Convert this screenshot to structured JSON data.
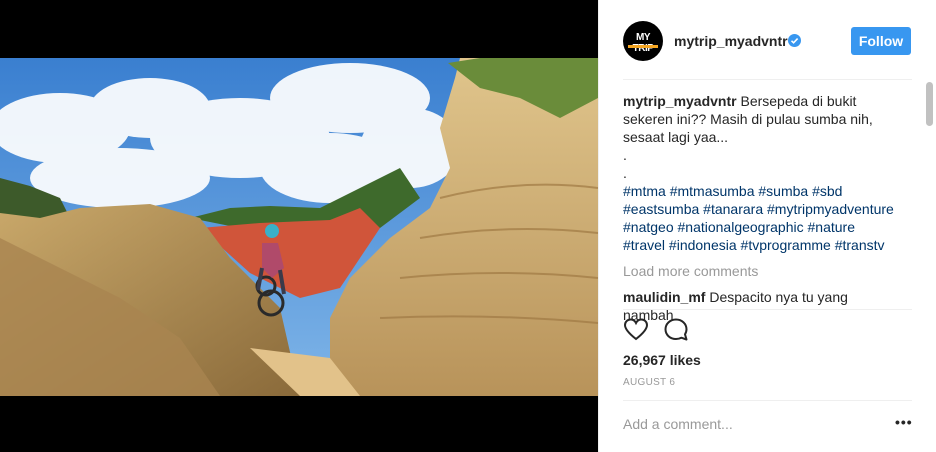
{
  "post": {
    "username": "mytrip_myadvntr",
    "verified": true,
    "follow_label": "Follow",
    "avatar_text": "MY TRIP",
    "caption": {
      "username": "mytrip_myadvntr",
      "line1": "Bersepeda di bukit",
      "line1_tail": "sekeren ini?? Masih di pulau sumba nih, sesaat lagi yaa...",
      "dot1": ".",
      "dot2": "."
    },
    "hashtags": [
      "#mtma",
      "#mtmasumba",
      "#sumba",
      "#sbd",
      "#eastsumba",
      "#tanarara",
      "#mytripmyadventure",
      "#natgeo",
      "#nationalgeographic",
      "#nature",
      "#travel",
      "#indonesia",
      "#tvprogramme",
      "#transtv"
    ],
    "load_more": "Load more comments",
    "comment": {
      "username": "maulidin_mf",
      "text": "Despacito nya tu yang nambah"
    },
    "likes": "26,967 likes",
    "date": "AUGUST 6",
    "add_comment_placeholder": "Add a comment...",
    "more_options": "•••"
  },
  "icons": {
    "like": "heart-icon",
    "comment": "comment-icon",
    "verified": "verified-badge-icon",
    "more": "more-options-icon"
  },
  "colors": {
    "accent": "#3897f0",
    "hashtag": "#003569",
    "muted": "#999999"
  }
}
